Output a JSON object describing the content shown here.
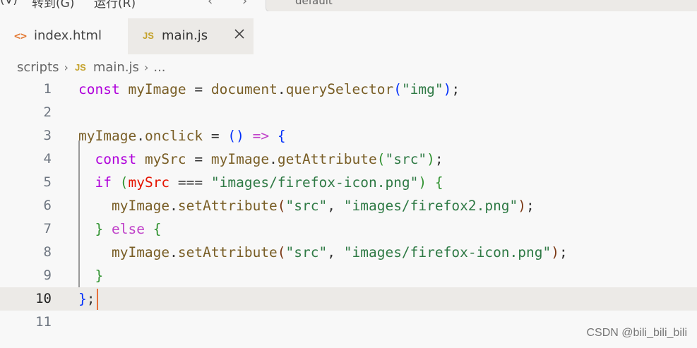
{
  "menubar": {
    "items": [
      {
        "id": "partial",
        "label": "(V)"
      },
      {
        "id": "goto",
        "label": "转到(G)"
      },
      {
        "id": "run",
        "label": "运行(R)"
      }
    ],
    "command_center_label": "default"
  },
  "tabs": [
    {
      "label": "index.html",
      "icon": "code-brackets-icon",
      "active": false
    },
    {
      "label": "main.js",
      "icon": "js-file-icon",
      "badge": "JS",
      "active": true
    }
  ],
  "breadcrumb": {
    "items": [
      "scripts",
      "main.js",
      "..."
    ],
    "badge": "JS",
    "separator": "›"
  },
  "editor": {
    "current_line": 10,
    "line_numbers": [
      "1",
      "2",
      "3",
      "4",
      "5",
      "6",
      "7",
      "8",
      "9",
      "10",
      "11"
    ]
  },
  "watermark": "CSDN @bili_bili_bili",
  "colors": {
    "background": "#f8f8f8",
    "active_tab": "#eceae7",
    "keyword": "#af00db",
    "string": "#2f7a45",
    "cursor": "#e8703a"
  }
}
